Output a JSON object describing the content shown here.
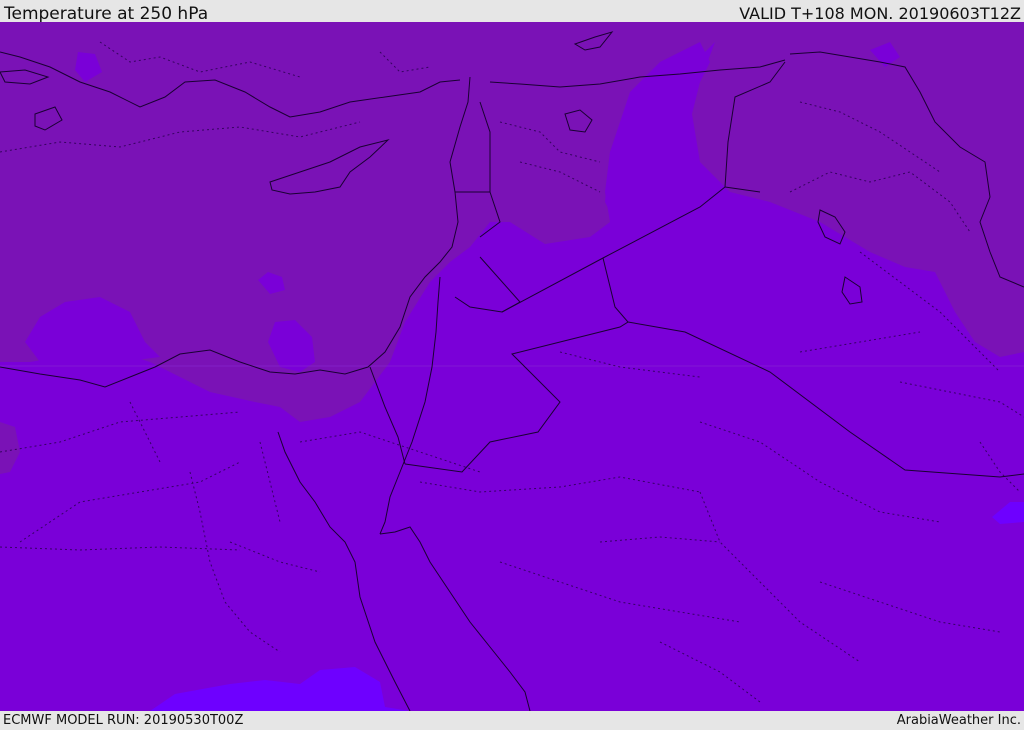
{
  "header": {
    "title": "Temperature at 250 hPa",
    "valid": "VALID T+108 MON. 20190603T12Z"
  },
  "footer": {
    "model_run": "ECMWF MODEL RUN: 20190530T00Z",
    "credit": "ArabiaWeather Inc."
  },
  "colors": {
    "band_cold": "#7a12b6",
    "band_mid": "#7a00d8",
    "band_warm": "#6e00ff",
    "coast_line": "#1a0033",
    "border_line": "#2a0050"
  }
}
